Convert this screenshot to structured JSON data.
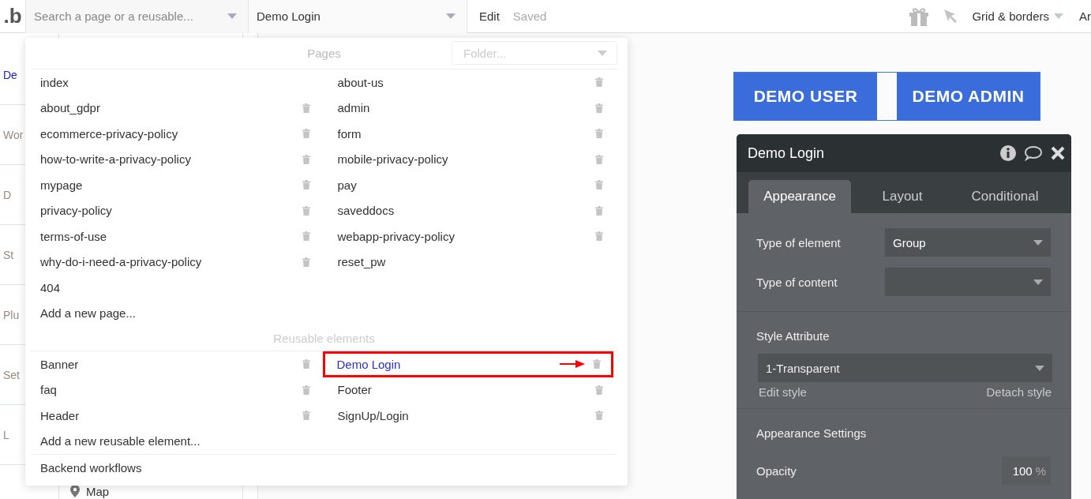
{
  "topbar": {
    "logo": ".b",
    "search": {
      "placeholder": "Search a page or a reusable..."
    },
    "current_page": "Demo Login",
    "mode": "Edit",
    "save_status": "Saved",
    "grid_menu": "Grid & borders",
    "cut_menu": "Ar"
  },
  "sidebar": {
    "tabs": [
      {
        "label": "De",
        "selected": true
      },
      {
        "label": "Wor",
        "selected": false
      },
      {
        "label": "D",
        "selected": false
      },
      {
        "label": "St",
        "selected": false
      },
      {
        "label": "Plu",
        "selected": false
      },
      {
        "label": "Set",
        "selected": false
      },
      {
        "label": "L",
        "selected": false
      }
    ]
  },
  "element_tree": {
    "items": [
      "Map"
    ]
  },
  "page_picker": {
    "folder": {
      "placeholder": "Folder..."
    },
    "pages_heading": "Pages",
    "pages": [
      {
        "name": "index",
        "deletable": false
      },
      {
        "name": "about-us",
        "deletable": true
      },
      {
        "name": "about_gdpr",
        "deletable": true
      },
      {
        "name": "admin",
        "deletable": true
      },
      {
        "name": "ecommerce-privacy-policy",
        "deletable": true
      },
      {
        "name": "form",
        "deletable": true
      },
      {
        "name": "how-to-write-a-privacy-policy",
        "deletable": true
      },
      {
        "name": "mobile-privacy-policy",
        "deletable": true
      },
      {
        "name": "mypage",
        "deletable": true
      },
      {
        "name": "pay",
        "deletable": true
      },
      {
        "name": "privacy-policy",
        "deletable": true
      },
      {
        "name": "saveddocs",
        "deletable": true
      },
      {
        "name": "terms-of-use",
        "deletable": true
      },
      {
        "name": "webapp-privacy-policy",
        "deletable": true
      },
      {
        "name": "why-do-i-need-a-privacy-policy",
        "deletable": true
      },
      {
        "name": "reset_pw",
        "deletable": false
      },
      {
        "name": "404",
        "deletable": false
      }
    ],
    "add_page": "Add a new page...",
    "reusable_heading": "Reusable elements",
    "reusables": [
      {
        "name": "Banner",
        "selected": false,
        "annotated": false
      },
      {
        "name": "Demo Login",
        "selected": true,
        "annotated": true
      },
      {
        "name": "faq",
        "selected": false,
        "annotated": false
      },
      {
        "name": "Footer",
        "selected": false,
        "annotated": false
      },
      {
        "name": "Header",
        "selected": false,
        "annotated": false
      },
      {
        "name": "SignUp/Login",
        "selected": false,
        "annotated": false
      }
    ],
    "add_reusable": "Add a new reusable element...",
    "backend": "Backend workflows"
  },
  "canvas": {
    "buttons": [
      "DEMO USER",
      "DEMO ADMIN"
    ]
  },
  "property_editor": {
    "title": "Demo Login",
    "tabs": [
      {
        "label": "Appearance",
        "selected": true
      },
      {
        "label": "Layout",
        "selected": false
      },
      {
        "label": "Conditional",
        "selected": false
      }
    ],
    "fields": [
      {
        "label": "Type of element",
        "value": "Group"
      },
      {
        "label": "Type of content"
      }
    ],
    "style_attribute": {
      "label": "Style Attribute",
      "value": "1-Transparent",
      "edit": "Edit style",
      "detach": "Detach style"
    },
    "appearance_settings": "Appearance Settings",
    "opacity": {
      "label": "Opacity",
      "value": "100",
      "unit": "%"
    }
  }
}
